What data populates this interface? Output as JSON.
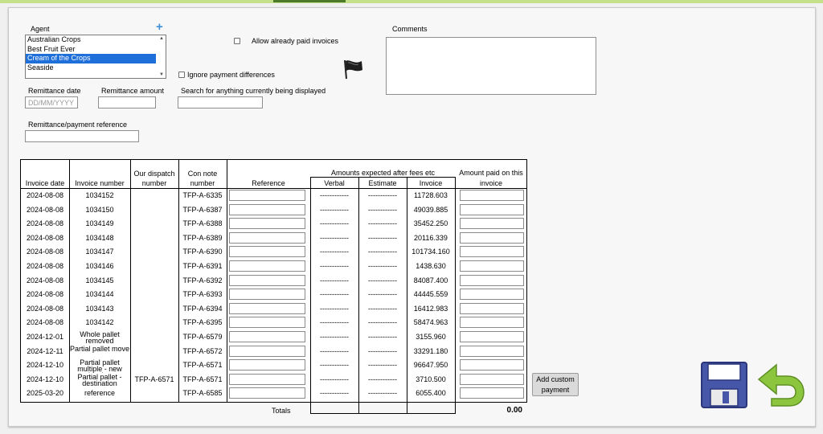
{
  "agent": {
    "label": "Agent",
    "add_symbol": "+",
    "options": [
      "Australian Crops",
      "Best Fruit Ever",
      "Cream of the Crops",
      "Seaside"
    ],
    "selected_index": 2
  },
  "allow_paid_label": "Allow already paid invoices",
  "ignore_diff_label": "Ignore payment differences",
  "comments_label": "Comments",
  "remittance_date": {
    "label": "Remittance date",
    "placeholder": "DD/MM/YYYY"
  },
  "remittance_amount_label": "Remittance amount",
  "search_label": "Search for anything currently being displayed",
  "payment_ref_label": "Remittance/payment reference",
  "table": {
    "headers": {
      "invoice_date": "Invoice date",
      "invoice_number": "Invoice number",
      "dispatch": [
        "Our dispatch",
        "number"
      ],
      "con_note": [
        "Con note",
        "number"
      ],
      "reference": "Reference",
      "amounts_group": "Amounts expected after fees etc",
      "verbal": "Verbal",
      "estimate": "Estimate",
      "invoice": "Invoice",
      "amount_paid": [
        "Amount paid on this",
        "invoice"
      ]
    },
    "rows": [
      {
        "date": "2024-08-08",
        "number": "1034152",
        "dispatch": "",
        "con": "TFP-A-6335",
        "verbal": "------------",
        "estimate": "------------",
        "invoice": "11728.603"
      },
      {
        "date": "2024-08-08",
        "number": "1034150",
        "dispatch": "",
        "con": "TFP-A-6387",
        "verbal": "------------",
        "estimate": "------------",
        "invoice": "49039.885"
      },
      {
        "date": "2024-08-08",
        "number": "1034149",
        "dispatch": "",
        "con": "TFP-A-6388",
        "verbal": "------------",
        "estimate": "------------",
        "invoice": "35452.250"
      },
      {
        "date": "2024-08-08",
        "number": "1034148",
        "dispatch": "",
        "con": "TFP-A-6389",
        "verbal": "------------",
        "estimate": "------------",
        "invoice": "20116.339"
      },
      {
        "date": "2024-08-08",
        "number": "1034147",
        "dispatch": "",
        "con": "TFP-A-6390",
        "verbal": "------------",
        "estimate": "------------",
        "invoice": "101734.160"
      },
      {
        "date": "2024-08-08",
        "number": "1034146",
        "dispatch": "",
        "con": "TFP-A-6391",
        "verbal": "------------",
        "estimate": "------------",
        "invoice": "1438.630"
      },
      {
        "date": "2024-08-08",
        "number": "1034145",
        "dispatch": "",
        "con": "TFP-A-6392",
        "verbal": "------------",
        "estimate": "------------",
        "invoice": "84087.400"
      },
      {
        "date": "2024-08-08",
        "number": "1034144",
        "dispatch": "",
        "con": "TFP-A-6393",
        "verbal": "------------",
        "estimate": "------------",
        "invoice": "44445.559"
      },
      {
        "date": "2024-08-08",
        "number": "1034143",
        "dispatch": "",
        "con": "TFP-A-6394",
        "verbal": "------------",
        "estimate": "------------",
        "invoice": "16412.983"
      },
      {
        "date": "2024-08-08",
        "number": "1034142",
        "dispatch": "",
        "con": "TFP-A-6395",
        "verbal": "------------",
        "estimate": "------------",
        "invoice": "58474.963"
      },
      {
        "date": "2024-12-01",
        "number": "Whole pallet removed",
        "dispatch": "",
        "con": "TFP-A-6579",
        "verbal": "------------",
        "estimate": "------------",
        "invoice": "3155.960"
      },
      {
        "date": "2024-12-11",
        "number": "Partial pallet move",
        "dispatch": "",
        "con": "TFP-A-6572",
        "verbal": "------------",
        "estimate": "------------",
        "invoice": "33291.180"
      },
      {
        "date": "2024-12-10",
        "number": "Partial pallet multiple - new invoice",
        "dispatch": "",
        "con": "TFP-A-6571",
        "verbal": "------------",
        "estimate": "------------",
        "invoice": "96647.950"
      },
      {
        "date": "2024-12-10",
        "number": "Partial pallet - destination",
        "dispatch": "TFP-A-6571",
        "con": "TFP-A-6571",
        "verbal": "------------",
        "estimate": "------------",
        "invoice": "3710.500"
      },
      {
        "date": "2025-03-20",
        "number": "reference",
        "dispatch": "",
        "con": "TFP-A-6585",
        "verbal": "------------",
        "estimate": "------------",
        "invoice": "6055.400"
      }
    ],
    "totals_label": "Totals",
    "paid_total": "0.00"
  },
  "add_custom_payment_label": "Add custom payment",
  "icons": {
    "flag": "flag-icon",
    "save": "floppy-disk-icon",
    "undo": "undo-arrow-icon"
  },
  "colors": {
    "selection": "#1e6fd9",
    "plus": "#3d8fd6",
    "save": "#4656a8",
    "undo": "#8cc63f"
  }
}
